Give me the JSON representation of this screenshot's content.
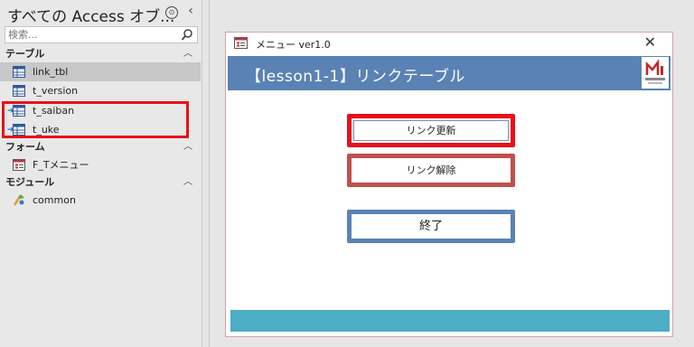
{
  "nav": {
    "title": "すべての Access オブ...",
    "menu_glyph": "⊙",
    "close_glyph": "‹",
    "search_placeholder": "検索...",
    "groups": [
      {
        "label": "テーブル",
        "items": [
          {
            "label": "link_tbl",
            "icon": "table-icon",
            "linked": false,
            "selected": true
          },
          {
            "label": "t_version",
            "icon": "table-icon",
            "linked": false,
            "selected": false
          },
          {
            "label": "t_saiban",
            "icon": "linked-table-icon",
            "linked": true,
            "selected": false
          },
          {
            "label": "t_uke",
            "icon": "linked-table-icon",
            "linked": true,
            "selected": false
          }
        ]
      },
      {
        "label": "フォーム",
        "items": [
          {
            "label": "F_Tメニュー",
            "icon": "form-icon",
            "linked": false,
            "selected": false
          }
        ]
      },
      {
        "label": "モジュール",
        "items": [
          {
            "label": "common",
            "icon": "module-icon",
            "linked": false,
            "selected": false
          }
        ]
      }
    ]
  },
  "form": {
    "window_title": "メニュー ver1.0",
    "close_glyph": "✕",
    "header_title": "【lesson1-1】リンクテーブル",
    "buttons": {
      "update_label": "リンク更新",
      "release_label": "リンク解除",
      "exit_label": "終了"
    }
  },
  "colors": {
    "highlight_red": "#e8101a",
    "header_blue": "#5a82b4",
    "footer_teal": "#4badc6",
    "release_border": "#c0504d"
  }
}
